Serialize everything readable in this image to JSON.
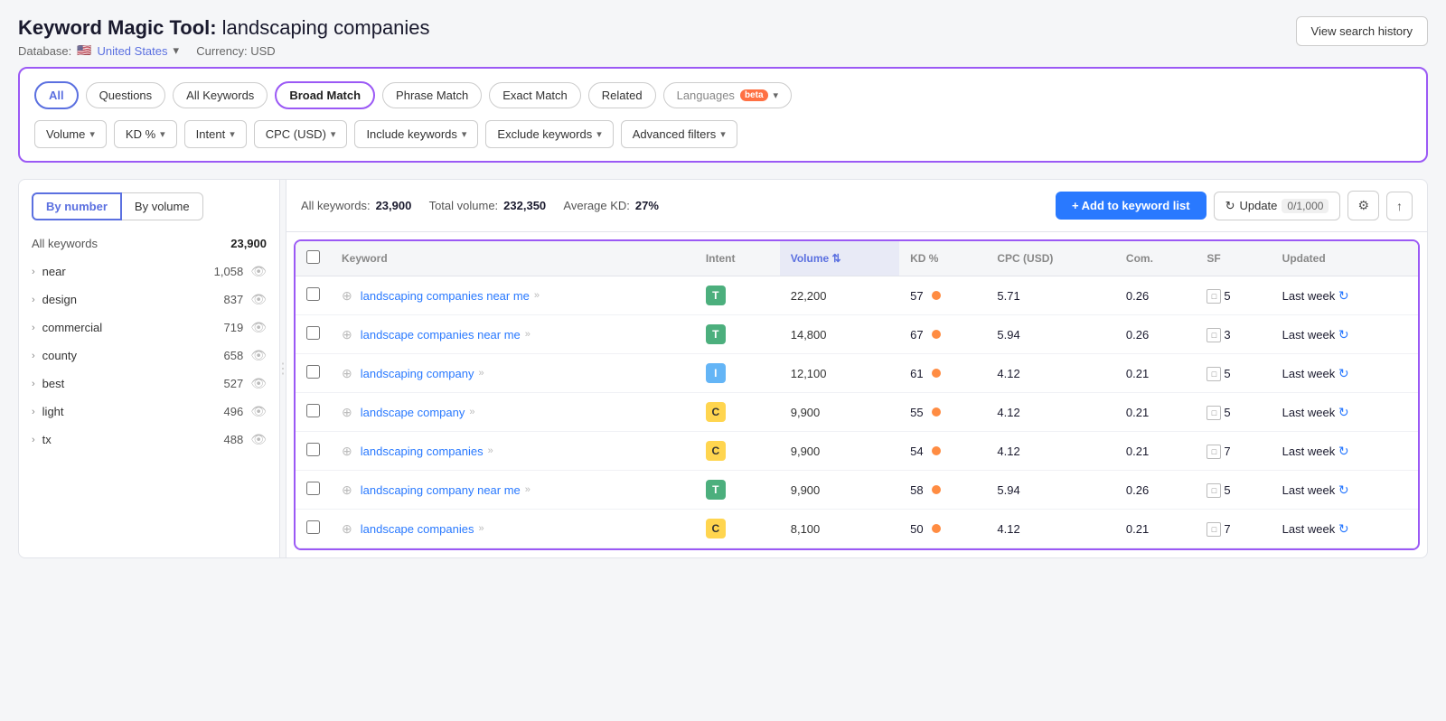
{
  "page": {
    "title": "Keyword Magic Tool:",
    "query": "landscaping companies",
    "database_label": "Database:",
    "database_value": "United States",
    "currency_label": "Currency: USD",
    "view_history_btn": "View search history"
  },
  "filter_tabs": [
    {
      "id": "all",
      "label": "All",
      "active": true
    },
    {
      "id": "questions",
      "label": "Questions",
      "active": false
    },
    {
      "id": "all-keywords",
      "label": "All Keywords",
      "active": false
    },
    {
      "id": "broad-match",
      "label": "Broad Match",
      "active": false,
      "selected": true
    },
    {
      "id": "phrase-match",
      "label": "Phrase Match",
      "active": false
    },
    {
      "id": "exact-match",
      "label": "Exact Match",
      "active": false
    },
    {
      "id": "related",
      "label": "Related",
      "active": false
    }
  ],
  "languages_btn": "Languages",
  "beta_label": "beta",
  "filter_dropdowns": [
    {
      "id": "volume",
      "label": "Volume"
    },
    {
      "id": "kd",
      "label": "KD %"
    },
    {
      "id": "intent",
      "label": "Intent"
    },
    {
      "id": "cpc",
      "label": "CPC (USD)"
    },
    {
      "id": "include-kw",
      "label": "Include keywords"
    },
    {
      "id": "exclude-kw",
      "label": "Exclude keywords"
    },
    {
      "id": "advanced",
      "label": "Advanced filters"
    }
  ],
  "sidebar": {
    "by_number_btn": "By number",
    "by_volume_btn": "By volume",
    "all_keywords_label": "All keywords",
    "all_keywords_count": "23,900",
    "items": [
      {
        "label": "near",
        "count": "1,058"
      },
      {
        "label": "design",
        "count": "837"
      },
      {
        "label": "commercial",
        "count": "719"
      },
      {
        "label": "county",
        "count": "658"
      },
      {
        "label": "best",
        "count": "527"
      },
      {
        "label": "light",
        "count": "496"
      },
      {
        "label": "tx",
        "count": "488"
      }
    ]
  },
  "table_bar": {
    "all_keywords_label": "All keywords:",
    "all_keywords_value": "23,900",
    "total_volume_label": "Total volume:",
    "total_volume_value": "232,350",
    "avg_kd_label": "Average KD:",
    "avg_kd_value": "27%",
    "add_btn": "+ Add to keyword list",
    "update_btn": "Update",
    "update_count": "0/1,000"
  },
  "table_columns": [
    {
      "id": "keyword",
      "label": "Keyword"
    },
    {
      "id": "intent",
      "label": "Intent"
    },
    {
      "id": "volume",
      "label": "Volume",
      "sorted": true
    },
    {
      "id": "kd",
      "label": "KD %"
    },
    {
      "id": "cpc",
      "label": "CPC (USD)"
    },
    {
      "id": "com",
      "label": "Com."
    },
    {
      "id": "sf",
      "label": "SF"
    },
    {
      "id": "updated",
      "label": "Updated"
    }
  ],
  "table_rows": [
    {
      "keyword": "landscaping companies near me",
      "intent": "T",
      "intent_type": "t",
      "volume": "22,200",
      "kd": "57",
      "cpc": "5.71",
      "com": "0.26",
      "sf": "5",
      "updated": "Last week"
    },
    {
      "keyword": "landscape companies near me",
      "intent": "T",
      "intent_type": "t",
      "volume": "14,800",
      "kd": "67",
      "cpc": "5.94",
      "com": "0.26",
      "sf": "3",
      "updated": "Last week"
    },
    {
      "keyword": "landscaping company",
      "intent": "I",
      "intent_type": "i",
      "volume": "12,100",
      "kd": "61",
      "cpc": "4.12",
      "com": "0.21",
      "sf": "5",
      "updated": "Last week"
    },
    {
      "keyword": "landscape company",
      "intent": "C",
      "intent_type": "c",
      "volume": "9,900",
      "kd": "55",
      "cpc": "4.12",
      "com": "0.21",
      "sf": "5",
      "updated": "Last week"
    },
    {
      "keyword": "landscaping companies",
      "intent": "C",
      "intent_type": "c",
      "volume": "9,900",
      "kd": "54",
      "cpc": "4.12",
      "com": "0.21",
      "sf": "7",
      "updated": "Last week"
    },
    {
      "keyword": "landscaping company near me",
      "intent": "T",
      "intent_type": "t",
      "volume": "9,900",
      "kd": "58",
      "cpc": "5.94",
      "com": "0.26",
      "sf": "5",
      "updated": "Last week"
    },
    {
      "keyword": "landscape companies",
      "intent": "C",
      "intent_type": "c",
      "volume": "8,100",
      "kd": "50",
      "cpc": "4.12",
      "com": "0.21",
      "sf": "7",
      "updated": "Last week"
    }
  ]
}
